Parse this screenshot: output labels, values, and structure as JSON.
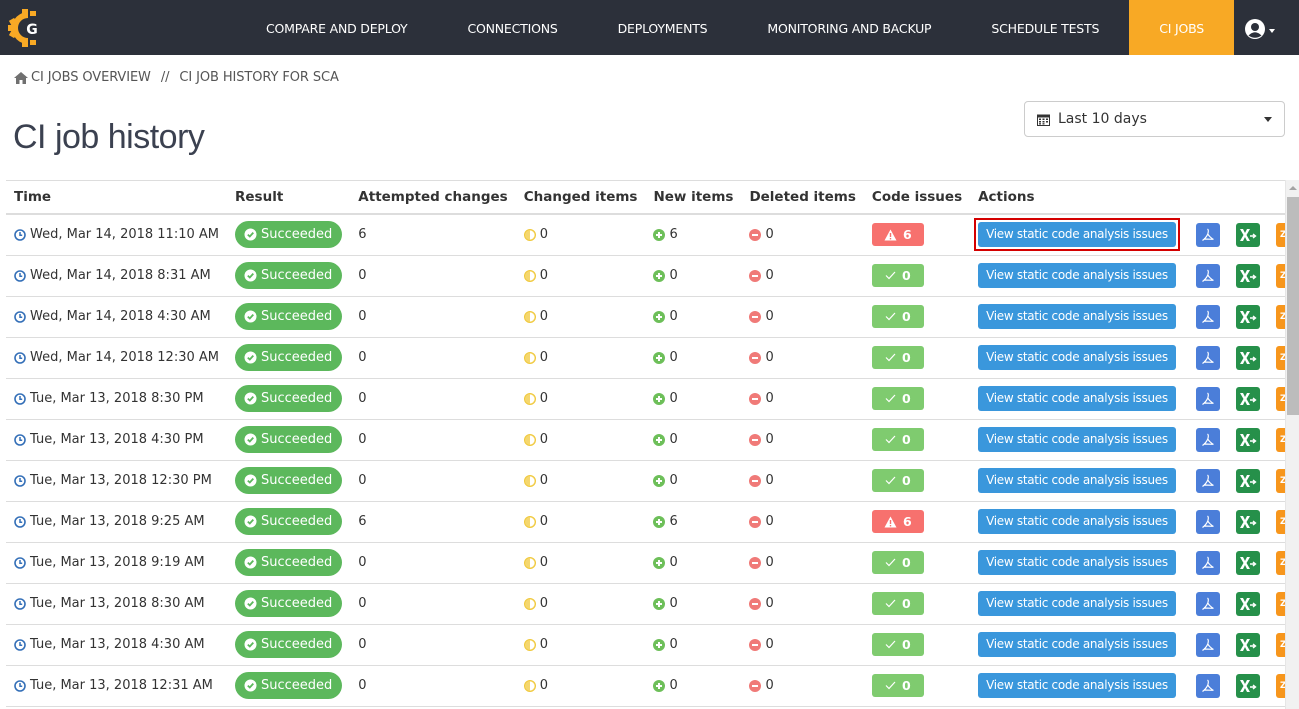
{
  "nav": {
    "logo_letter": "G",
    "items": [
      {
        "label": "COMPARE AND DEPLOY",
        "active": false
      },
      {
        "label": "CONNECTIONS",
        "active": false
      },
      {
        "label": "DEPLOYMENTS",
        "active": false
      },
      {
        "label": "MONITORING AND BACKUP",
        "active": false
      },
      {
        "label": "SCHEDULE TESTS",
        "active": false
      },
      {
        "label": "CI JOBS",
        "active": true
      }
    ],
    "user_icon": "user-circle-icon"
  },
  "breadcrumb": {
    "home_icon": "home-icon",
    "items": [
      "CI JOBS OVERVIEW",
      "CI JOB HISTORY FOR SCA"
    ],
    "separator": "//"
  },
  "page_title": "CI job history",
  "date_filter": {
    "icon": "calendar-icon",
    "selected": "Last 10 days"
  },
  "table": {
    "columns": [
      "Time",
      "Result",
      "Attempted changes",
      "Changed items",
      "New items",
      "Deleted items",
      "Code issues",
      "Actions"
    ],
    "action_labels": {
      "view": "View static code analysis issues",
      "zip": "ZIP"
    },
    "rows": [
      {
        "time": "Wed, Mar 14, 2018 11:10 AM",
        "result": "Succeeded",
        "attempted": "6",
        "changed": "0",
        "new": "6",
        "deleted": "0",
        "code_issues": "6",
        "code_status": "warn",
        "highlighted": true
      },
      {
        "time": "Wed, Mar 14, 2018 8:31 AM",
        "result": "Succeeded",
        "attempted": "0",
        "changed": "0",
        "new": "0",
        "deleted": "0",
        "code_issues": "0",
        "code_status": "ok",
        "highlighted": false
      },
      {
        "time": "Wed, Mar 14, 2018 4:30 AM",
        "result": "Succeeded",
        "attempted": "0",
        "changed": "0",
        "new": "0",
        "deleted": "0",
        "code_issues": "0",
        "code_status": "ok",
        "highlighted": false
      },
      {
        "time": "Wed, Mar 14, 2018 12:30 AM",
        "result": "Succeeded",
        "attempted": "0",
        "changed": "0",
        "new": "0",
        "deleted": "0",
        "code_issues": "0",
        "code_status": "ok",
        "highlighted": false
      },
      {
        "time": "Tue, Mar 13, 2018 8:30 PM",
        "result": "Succeeded",
        "attempted": "0",
        "changed": "0",
        "new": "0",
        "deleted": "0",
        "code_issues": "0",
        "code_status": "ok",
        "highlighted": false
      },
      {
        "time": "Tue, Mar 13, 2018 4:30 PM",
        "result": "Succeeded",
        "attempted": "0",
        "changed": "0",
        "new": "0",
        "deleted": "0",
        "code_issues": "0",
        "code_status": "ok",
        "highlighted": false
      },
      {
        "time": "Tue, Mar 13, 2018 12:30 PM",
        "result": "Succeeded",
        "attempted": "0",
        "changed": "0",
        "new": "0",
        "deleted": "0",
        "code_issues": "0",
        "code_status": "ok",
        "highlighted": false
      },
      {
        "time": "Tue, Mar 13, 2018 9:25 AM",
        "result": "Succeeded",
        "attempted": "6",
        "changed": "0",
        "new": "6",
        "deleted": "0",
        "code_issues": "6",
        "code_status": "warn",
        "highlighted": false
      },
      {
        "time": "Tue, Mar 13, 2018 9:19 AM",
        "result": "Succeeded",
        "attempted": "0",
        "changed": "0",
        "new": "0",
        "deleted": "0",
        "code_issues": "0",
        "code_status": "ok",
        "highlighted": false
      },
      {
        "time": "Tue, Mar 13, 2018 8:30 AM",
        "result": "Succeeded",
        "attempted": "0",
        "changed": "0",
        "new": "0",
        "deleted": "0",
        "code_issues": "0",
        "code_status": "ok",
        "highlighted": false
      },
      {
        "time": "Tue, Mar 13, 2018 4:30 AM",
        "result": "Succeeded",
        "attempted": "0",
        "changed": "0",
        "new": "0",
        "deleted": "0",
        "code_issues": "0",
        "code_status": "ok",
        "highlighted": false
      },
      {
        "time": "Tue, Mar 13, 2018 12:31 AM",
        "result": "Succeeded",
        "attempted": "0",
        "changed": "0",
        "new": "0",
        "deleted": "0",
        "code_issues": "0",
        "code_status": "ok",
        "highlighted": false
      }
    ]
  },
  "colors": {
    "nav_bg": "#2c303a",
    "nav_active": "#f8a925",
    "success": "#5cb85c",
    "code_warn": "#f7716e",
    "code_ok": "#7fcb6f",
    "primary_button": "#3a97dc",
    "pdf": "#4b7ed9",
    "excel": "#26904a",
    "zip": "#f7961c",
    "highlight_border": "#d40000"
  }
}
